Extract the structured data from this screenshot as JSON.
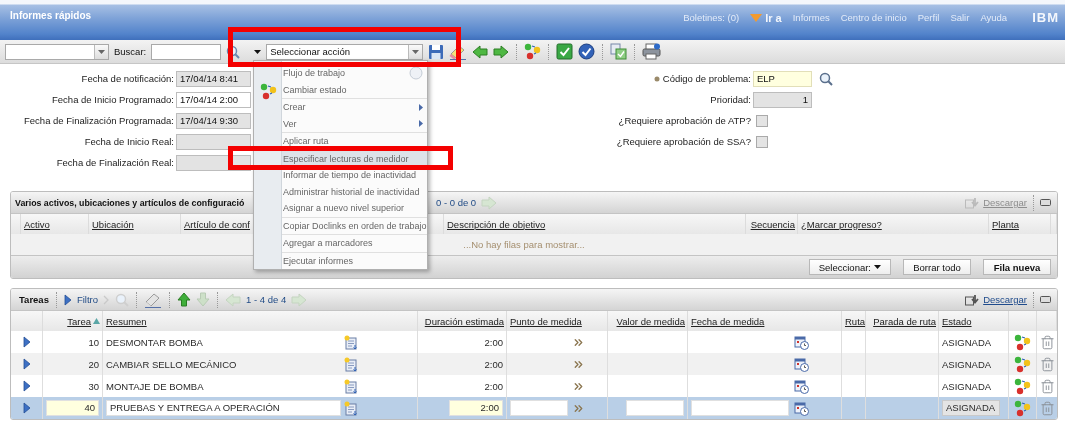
{
  "header": {
    "title": "Informes rápidos",
    "links": [
      {
        "label": "Boletines: (0)",
        "kind": "link"
      },
      {
        "label": "Ir a",
        "kind": "menu"
      },
      {
        "label": "Informes",
        "kind": "link"
      },
      {
        "label": "Centro de inicio",
        "kind": "link"
      },
      {
        "label": "Perfil",
        "kind": "link"
      },
      {
        "label": "Salir",
        "kind": "link"
      },
      {
        "label": "Ayuda",
        "kind": "link"
      }
    ],
    "logo": "IBM"
  },
  "toolbar": {
    "search_label": "Buscar:",
    "action_select": "Seleccionar acción"
  },
  "action_menu": {
    "groups": [
      [
        {
          "label": "Flujo de trabajo",
          "kind": "workflow",
          "selected": false
        },
        {
          "label": "Cambiar estado",
          "kind": "icon",
          "selected": false
        }
      ],
      [
        {
          "label": "Crear",
          "kind": "submenu",
          "selected": false
        },
        {
          "label": "Ver",
          "kind": "submenu",
          "selected": false
        }
      ],
      [
        {
          "label": "Aplicar ruta",
          "kind": "plain",
          "selected": false
        }
      ],
      [
        {
          "label": "Especificar lecturas de medidor",
          "kind": "plain",
          "selected": true
        },
        {
          "label": "Informar de tiempo de inactividad",
          "kind": "plain",
          "selected": false
        },
        {
          "label": "Administrar historial de inactividad",
          "kind": "plain",
          "selected": false
        },
        {
          "label": "Asignar a nuevo nivel superior",
          "kind": "plain",
          "selected": false
        }
      ],
      [
        {
          "label": "Copiar Doclinks en orden de trabajo",
          "kind": "plain",
          "selected": false
        }
      ],
      [
        {
          "label": "Agregar a marcadores",
          "kind": "plain",
          "selected": false
        }
      ],
      [
        {
          "label": "Ejecutar informes",
          "kind": "plain",
          "selected": false
        }
      ]
    ]
  },
  "form": {
    "left": [
      {
        "label": "Fecha de notificación:",
        "value": "17/04/14 8:41",
        "kind": "readonly"
      },
      {
        "label": "Fecha de Inicio Programado:",
        "value": "17/04/14 2:00",
        "kind": "editable"
      },
      {
        "label": "Fecha de Finalización Programada:",
        "value": "17/04/14 9:30",
        "kind": "readonly"
      },
      {
        "label": "Fecha de Inicio Real:",
        "kind": "readonly"
      },
      {
        "label": "Fecha de Finalización Real:",
        "kind": "readonly"
      }
    ],
    "right": [
      {
        "label": "Código de problema:",
        "value": "ELP",
        "kind": "lookup",
        "required": true
      },
      {
        "label": "Prioridad:",
        "value": "1",
        "kind": "number"
      },
      {
        "label": "¿Requiere aprobación de ATP?",
        "kind": "checkbox",
        "checked": false
      },
      {
        "label": "¿Requiere aprobación de SSA?",
        "kind": "checkbox",
        "checked": false
      }
    ]
  },
  "assets": {
    "title": "Varios activos, ubicaciones y artículos de configuració",
    "pager": {
      "text": "0 - 0 de 0",
      "next_disabled": true
    },
    "download": {
      "label": "Descargar",
      "disabled": true
    },
    "columns": [
      "Activo",
      "Ubicación",
      "Artículo de conf",
      "Descripción de objetivo",
      "Secuencia",
      "¿Marcar progreso?",
      "Planta"
    ],
    "empty_message": "...No hay filas para mostrar...",
    "buttons": [
      {
        "label": "Seleccionar:",
        "kind": "dropdown"
      },
      {
        "label": "Borrar todo",
        "kind": "plain"
      },
      {
        "label": "Fila nueva",
        "kind": "primary"
      }
    ]
  },
  "tasks": {
    "title": "Tareas",
    "filter": "Filtro",
    "tools": [
      {
        "kind": "next",
        "disabled": true
      },
      {
        "kind": "search",
        "disabled": true
      },
      {
        "kind": "clear",
        "disabled": true
      },
      {
        "kind": "up",
        "disabled": false
      },
      {
        "kind": "down",
        "disabled": true
      }
    ],
    "pager": {
      "text": "1 - 4 de 4",
      "prev_disabled": true,
      "next_disabled": true
    },
    "download": {
      "label": "Descargar",
      "disabled": false
    },
    "columns": [
      {
        "label": "Tarea",
        "sorted": true
      },
      {
        "label": "Resumen",
        "sorted": false
      },
      {
        "label": "Duración estimada",
        "sorted": false
      },
      {
        "label": "Punto de medida",
        "sorted": false
      },
      {
        "label": "Valor de medida",
        "sorted": false
      },
      {
        "label": "Fecha de medida",
        "sorted": false
      },
      {
        "label": "Ruta",
        "sorted": false
      },
      {
        "label": "Parada de ruta",
        "sorted": false
      },
      {
        "label": "Estado",
        "sorted": false
      }
    ],
    "rows": [
      {
        "task": "10",
        "summary": "DESMONTAR BOMBA",
        "duration": "2:00",
        "status": "ASIGNADA",
        "selected": false
      },
      {
        "task": "20",
        "summary": "CAMBIAR SELLO MECÁNICO",
        "duration": "2:00",
        "status": "ASIGNADA",
        "selected": false
      },
      {
        "task": "30",
        "summary": "MONTAJE DE BOMBA",
        "duration": "2:00",
        "status": "ASIGNADA",
        "selected": false
      },
      {
        "task": "40",
        "summary": "PRUEBAS Y ENTREGA A OPERACIÓN",
        "duration": "2:00",
        "status": "ASIGNADA",
        "selected": true
      }
    ]
  }
}
